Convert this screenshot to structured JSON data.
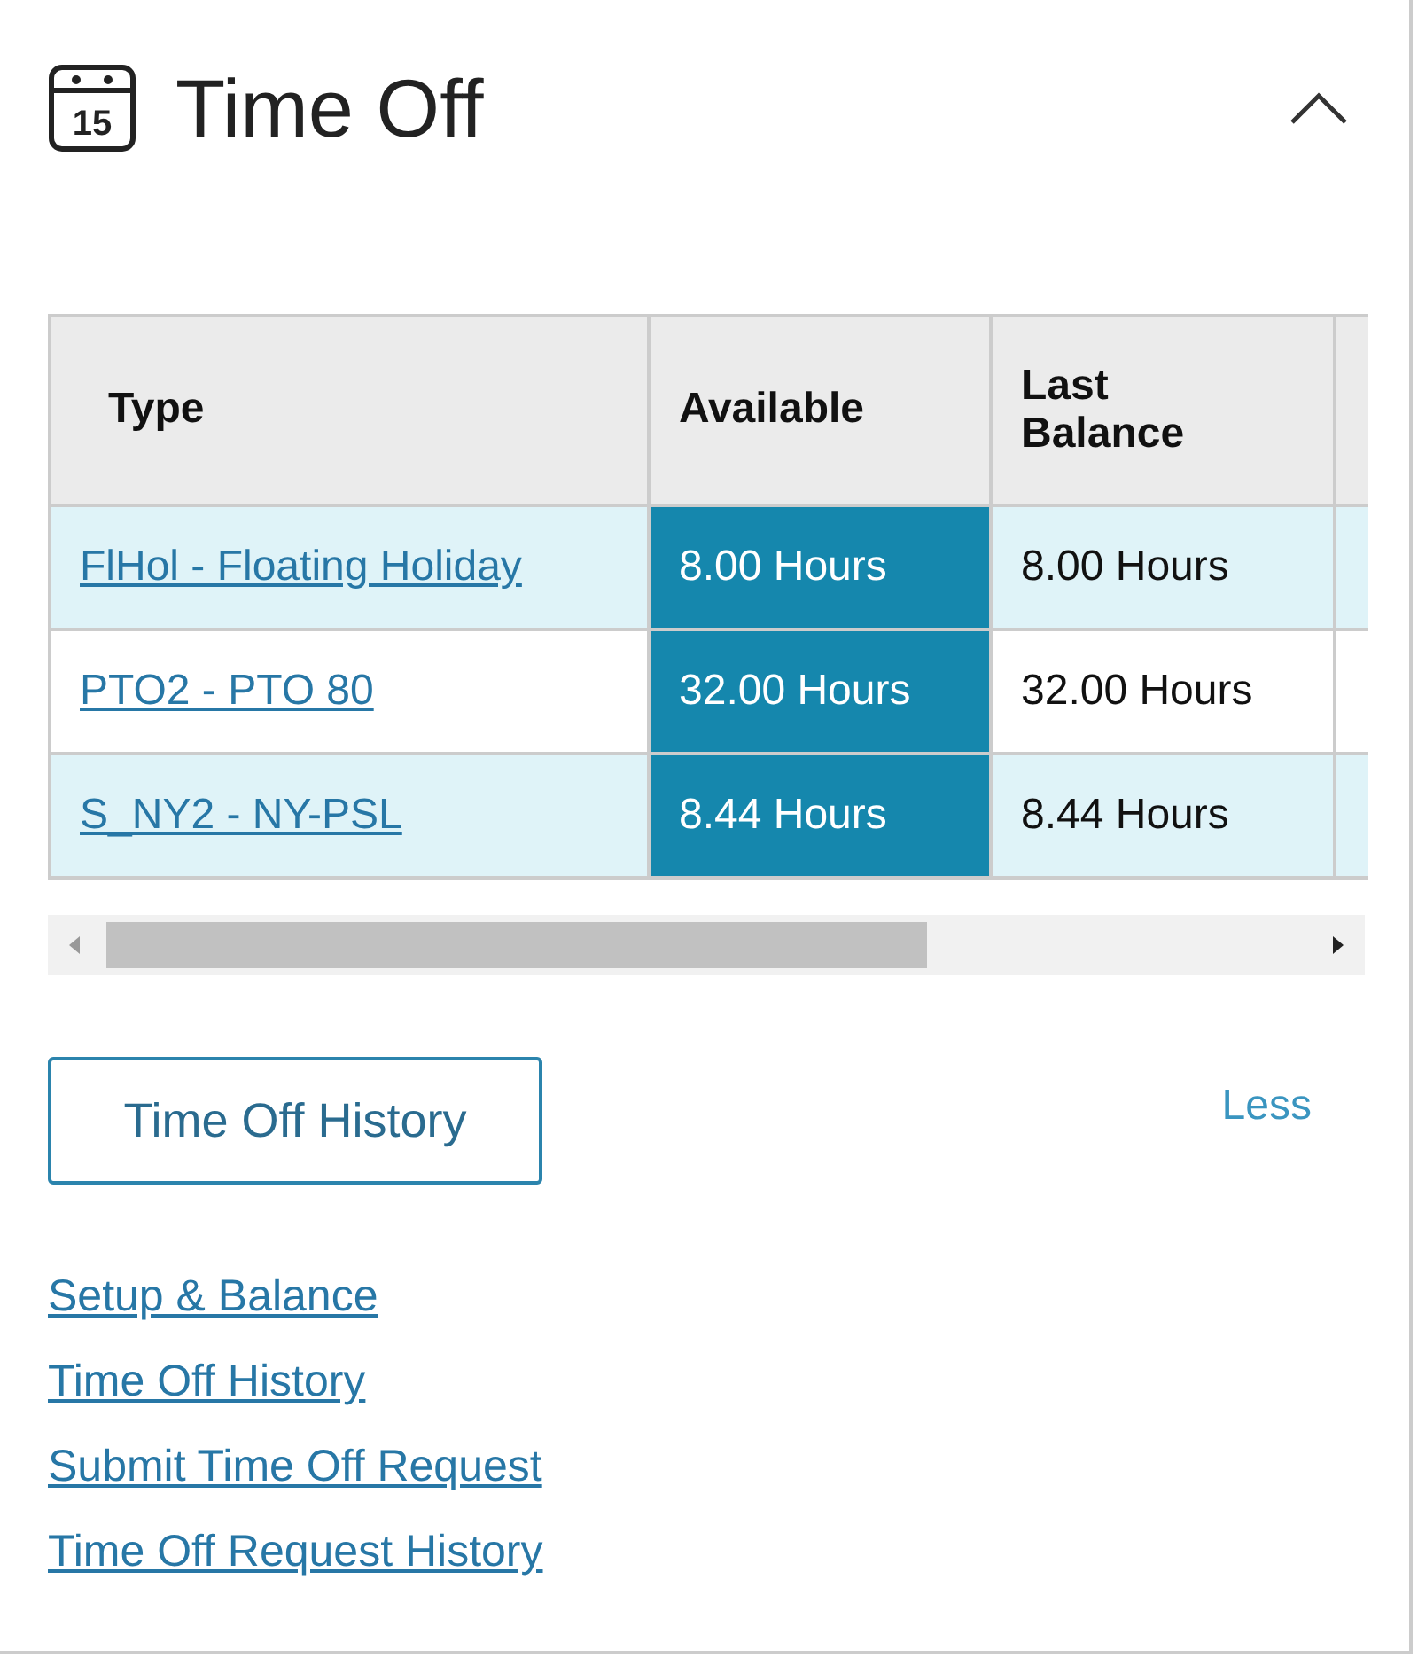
{
  "panel": {
    "title": "Time Off",
    "icon_day": "15",
    "expanded": true
  },
  "table": {
    "columns": [
      {
        "label": "Type",
        "highlighted": false
      },
      {
        "label": "Available",
        "highlighted": true
      },
      {
        "label": "Last Balance",
        "highlighted": false
      }
    ],
    "rows": [
      {
        "type": "FlHol - Floating Holiday",
        "available": "8.00 Hours",
        "last_balance": "8.00 Hours"
      },
      {
        "type": "PTO2 - PTO 80",
        "available": "32.00 Hours",
        "last_balance": "32.00 Hours"
      },
      {
        "type": "S_NY2 - NY-PSL",
        "available": "8.44 Hours",
        "last_balance": "8.44 Hours"
      }
    ]
  },
  "history_button": "Time Off History",
  "less_link": "Less",
  "links": [
    "Setup & Balance",
    "Time Off History",
    "Submit Time Off Request",
    "Time Off Request History"
  ]
}
